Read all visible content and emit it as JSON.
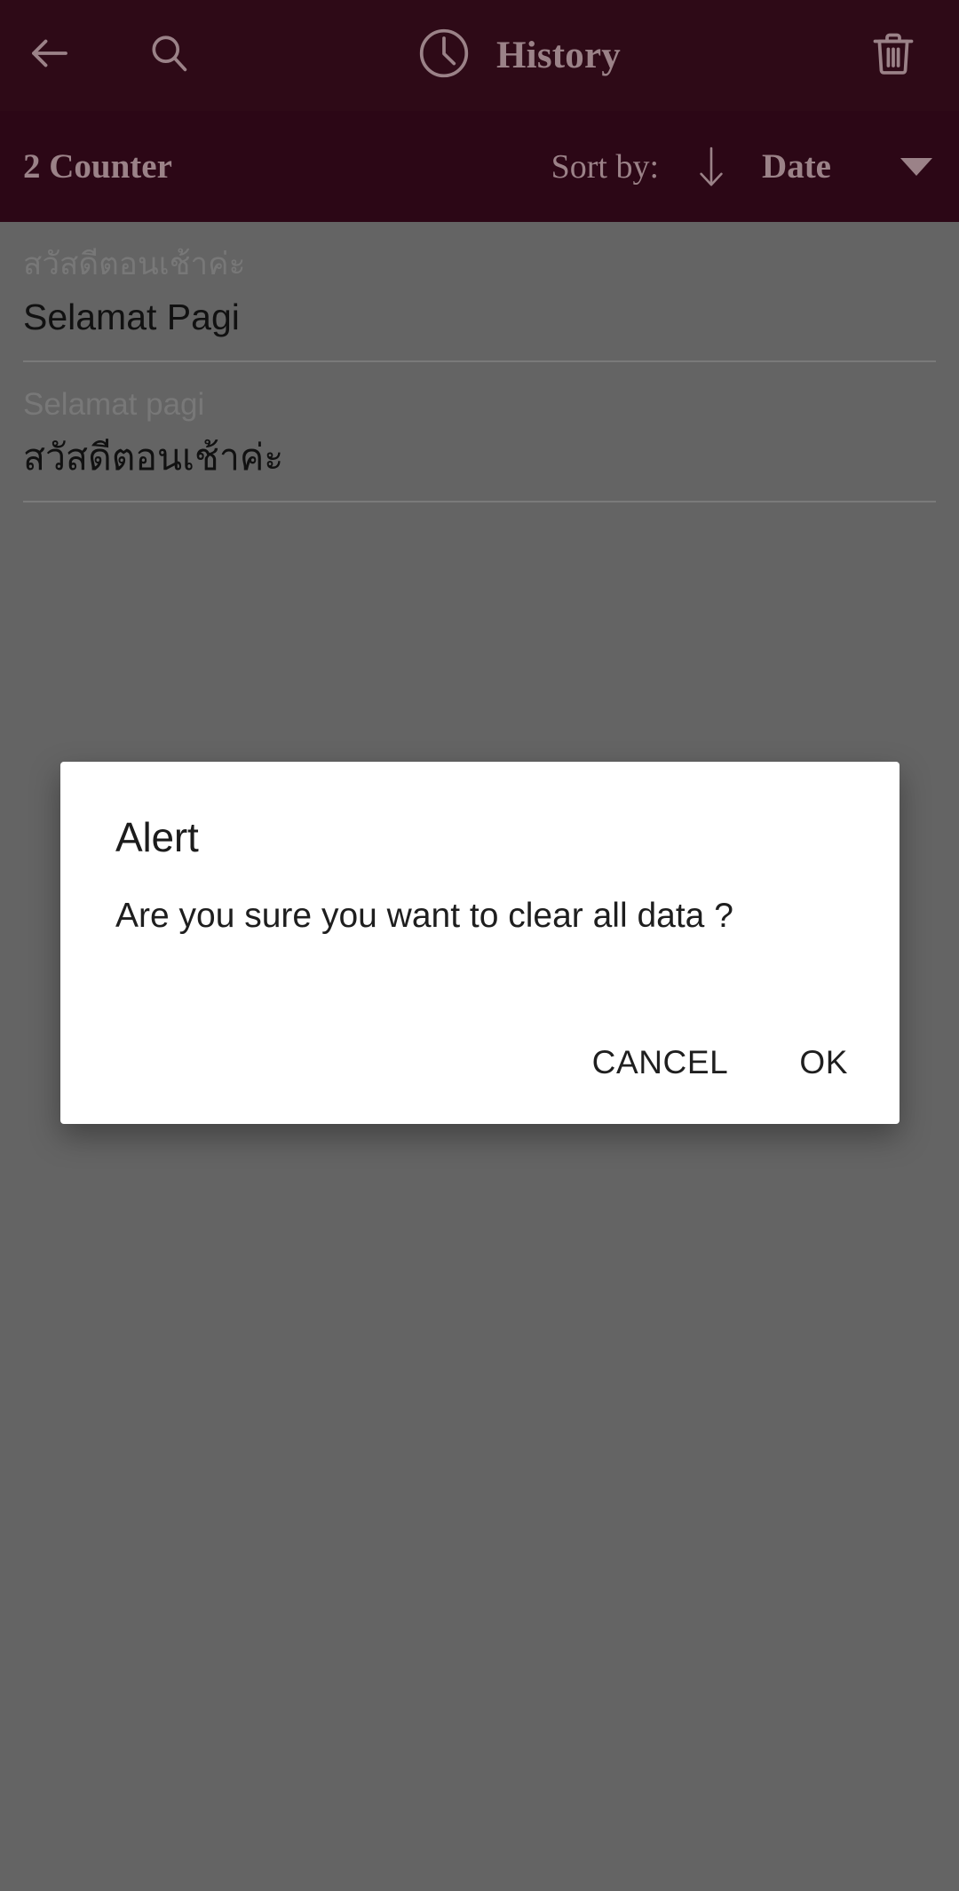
{
  "top_bar": {
    "back_icon": "arrow-left-icon",
    "search_icon": "search-icon",
    "clock_icon": "clock-icon",
    "title": "History",
    "delete_icon": "trash-icon",
    "background_color": "#2e0a17",
    "foreground_color": "#9b8288"
  },
  "sort_bar": {
    "counter_label": "2 Counter",
    "sort_by_label": "Sort by:",
    "sort_direction_icon": "arrow-down-icon",
    "sort_field": "Date",
    "dropdown_icon": "caret-down-icon",
    "background_color": "#2c0716"
  },
  "history": {
    "items": [
      {
        "source_text": "สวัสดีตอนเช้าค่ะ",
        "result_text": "Selamat Pagi"
      },
      {
        "source_text": "Selamat pagi",
        "result_text": "สวัสดีตอนเช้าค่ะ"
      }
    ]
  },
  "dialog": {
    "title": "Alert",
    "message": "Are you sure you want to clear all data ?",
    "cancel_label": "CANCEL",
    "ok_label": "OK",
    "background_color": "#ffffff"
  },
  "scrim": {
    "color": "#646464"
  }
}
